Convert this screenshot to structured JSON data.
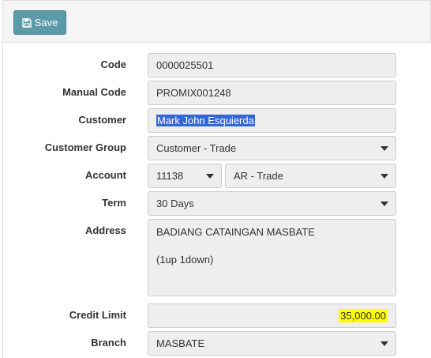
{
  "toolbar": {
    "save_label": "Save",
    "save_icon": "floppy-disk-icon"
  },
  "form": {
    "code": {
      "label": "Code",
      "value": "0000025501"
    },
    "manual_code": {
      "label": "Manual Code",
      "value": "PROMIX001248"
    },
    "customer": {
      "label": "Customer",
      "value": "Mark John Esquierda"
    },
    "customer_group": {
      "label": "Customer Group",
      "value": "Customer - Trade"
    },
    "account": {
      "label": "Account",
      "code_value": "11138",
      "name_value": "AR - Trade"
    },
    "term": {
      "label": "Term",
      "value": "30 Days"
    },
    "address": {
      "label": "Address",
      "value": "BADIANG CATAINGAN MASBATE\n\n(1up 1down)"
    },
    "credit_limit": {
      "label": "Credit Limit",
      "value": "35,000.00"
    },
    "branch": {
      "label": "Branch",
      "value": "MASBATE"
    }
  },
  "colors": {
    "save_button": "#5b9aa8",
    "selection": "#3367d6",
    "highlight": "#ffff00",
    "field_bg": "#eeeeee"
  }
}
